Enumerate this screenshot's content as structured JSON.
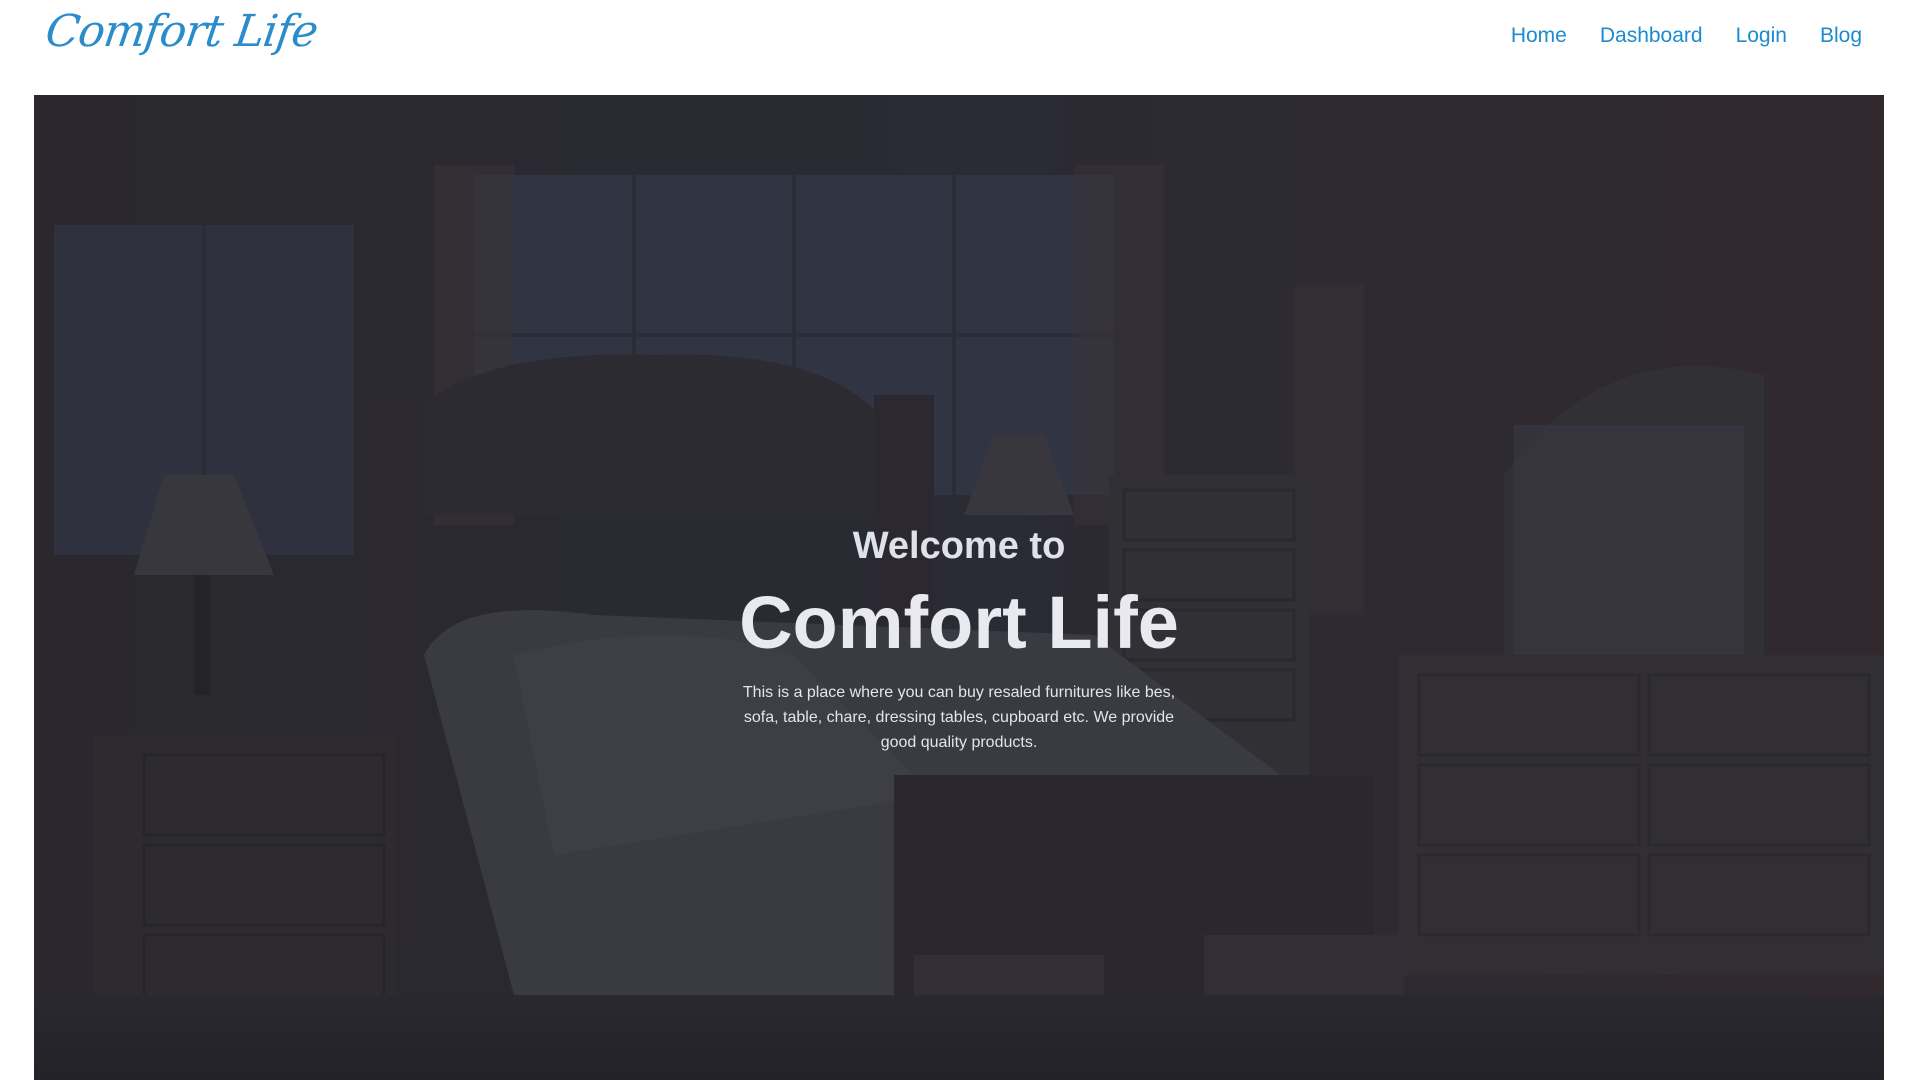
{
  "brand": {
    "logo_text": "Comfort Life",
    "accent_color": "#1c8bd0"
  },
  "nav": {
    "items": [
      {
        "label": "Home"
      },
      {
        "label": "Dashboard"
      },
      {
        "label": "Login"
      },
      {
        "label": "Blog"
      }
    ]
  },
  "hero": {
    "background": "bedroom-furniture-photo",
    "welcome": "Welcome to",
    "title": "Comfort Life",
    "description": "This is a place where you can buy resaled furnitures like bes, sofa, table, chare, dressing tables, cupboard etc. We provide good quality products."
  }
}
